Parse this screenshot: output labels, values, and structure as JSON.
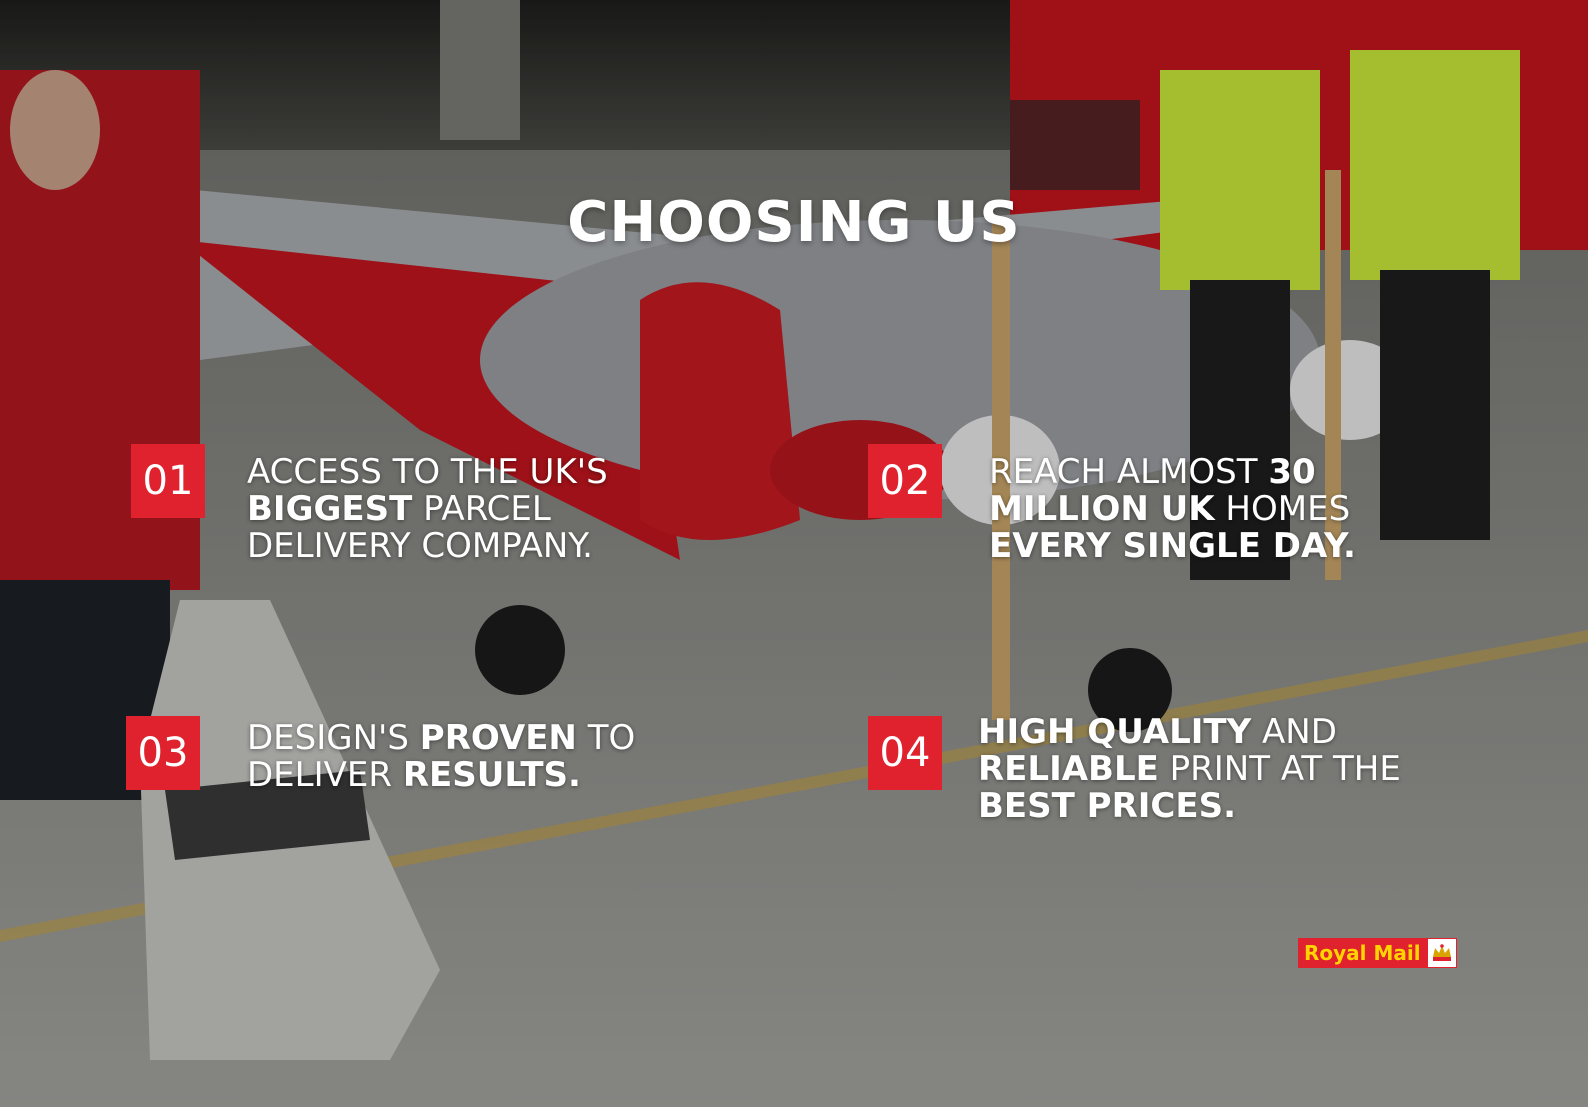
{
  "title": "CHOOSING US",
  "items": [
    {
      "number": "01",
      "parts": [
        "ACCESS TO THE UK'S ",
        "BIGGEST",
        " PARCEL DELIVERY COMPANY."
      ]
    },
    {
      "number": "02",
      "parts": [
        "REACH ALMOST ",
        "30 MILLION UK",
        " HOMES ",
        "EVERY SINGLE DAY."
      ]
    },
    {
      "number": "03",
      "parts": [
        "DESIGN'S ",
        "PROVEN",
        " TO DELIVER ",
        "RESULTS."
      ]
    },
    {
      "number": "04",
      "parts": [
        "HIGH QUALITY",
        " AND ",
        "RELIABLE",
        " PRINT AT THE ",
        "BEST PRICES."
      ]
    }
  ],
  "logo": {
    "text": "Royal Mail",
    "icon": "crown-icon"
  },
  "colors": {
    "accent": "#e0222e",
    "logo_text": "#ffd400"
  }
}
